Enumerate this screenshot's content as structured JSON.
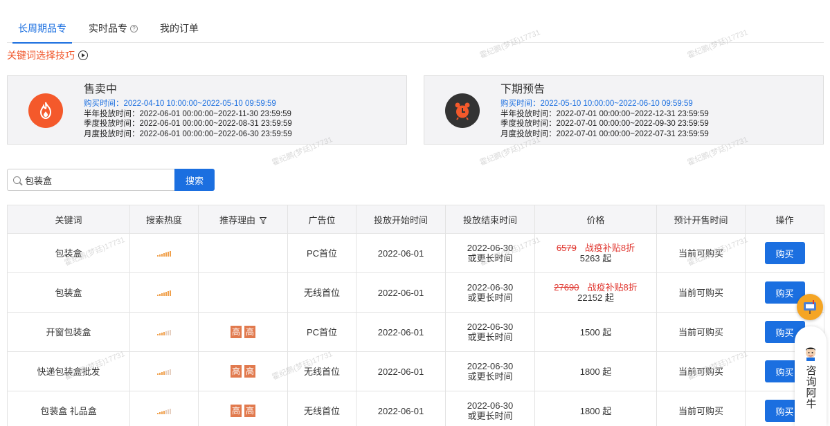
{
  "tabs": [
    {
      "label": "长周期品专",
      "active": true
    },
    {
      "label": "实时品专",
      "active": false,
      "has_help": true
    },
    {
      "label": "我的订单",
      "active": false
    }
  ],
  "tips": {
    "label": "关键词选择技巧",
    "icon": "play-circle-icon"
  },
  "panels": {
    "selling": {
      "title": "售卖中",
      "icon": "fire-icon",
      "icon_color": "#f4592b",
      "buy_time": "购买时间：2022-04-10 10:00:00~2022-05-10 09:59:59",
      "half_year": "半年投放时间：2022-06-01 00:00:00~2022-11-30 23:59:59",
      "quarter": "季度投放时间：2022-06-01 00:00:00~2022-08-31 23:59:59",
      "month": "月度投放时间：2022-06-01 00:00:00~2022-06-30 23:59:59"
    },
    "upcoming": {
      "title": "下期预告",
      "icon": "alarm-clock-icon",
      "icon_color": "#333333",
      "buy_time": "购买时间：2022-05-10 10:00:00~2022-06-10 09:59:59",
      "half_year": "半年投放时间：2022-07-01 00:00:00~2022-12-31 23:59:59",
      "quarter": "季度投放时间：2022-07-01 00:00:00~2022-09-30 23:59:59",
      "month": "月度投放时间：2022-07-01 00:00:00~2022-07-31 23:59:59"
    }
  },
  "search": {
    "value": "包装盒",
    "button": "搜索"
  },
  "table": {
    "headers": {
      "keyword": "关键词",
      "heat": "搜索热度",
      "reason": "推荐理由",
      "position": "广告位",
      "start": "投放开始时间",
      "end": "投放结束时间",
      "price": "价格",
      "sale_time": "预计开售时间",
      "action": "操作"
    },
    "rows": [
      {
        "keyword": "包装盒",
        "heat": 5,
        "tags": [],
        "position": "PC首位",
        "start": "2022-06-01",
        "end_line1": "2022-06-30",
        "end_line2": "或更长时间",
        "orig_price": "6579",
        "discount": "战疫补贴8折",
        "price": "5263 起",
        "sale_time": "当前可购买",
        "action": "购买"
      },
      {
        "keyword": "包装盒",
        "heat": 5,
        "tags": [],
        "position": "无线首位",
        "start": "2022-06-01",
        "end_line1": "2022-06-30",
        "end_line2": "或更长时间",
        "orig_price": "27690",
        "discount": "战疫补贴8折",
        "price": "22152 起",
        "sale_time": "当前可购买",
        "action": "购买"
      },
      {
        "keyword": "开窗包装盒",
        "heat": 2,
        "tags": [
          "高",
          "高"
        ],
        "position": "PC首位",
        "start": "2022-06-01",
        "end_line1": "2022-06-30",
        "end_line2": "或更长时间",
        "orig_price": "",
        "discount": "",
        "price": "1500 起",
        "sale_time": "当前可购买",
        "action": "购买"
      },
      {
        "keyword": "快递包装盒批发",
        "heat": 2,
        "tags": [
          "高",
          "高"
        ],
        "position": "无线首位",
        "start": "2022-06-01",
        "end_line1": "2022-06-30",
        "end_line2": "或更长时间",
        "orig_price": "",
        "discount": "",
        "price": "1800 起",
        "sale_time": "当前可购买",
        "action": "购买"
      },
      {
        "keyword": "包装盒 礼品盒",
        "heat": 2,
        "tags": [
          "高",
          "高"
        ],
        "position": "无线首位",
        "start": "2022-06-01",
        "end_line1": "2022-06-30",
        "end_line2": "或更长时间",
        "orig_price": "",
        "discount": "",
        "price": "1800 起",
        "sale_time": "当前可购买",
        "action": "购买"
      }
    ]
  },
  "float": {
    "consult_label": "咨询阿牛",
    "bubble_icon": "mailbox-icon",
    "avatar_icon": "cow-avatar-icon"
  },
  "watermark": "霍纪鹏(梦廷)17731",
  "colors": {
    "accent": "#1b6fe0",
    "warning": "#f0562a",
    "price_red": "#e0362f",
    "tag": "#e17a4e"
  }
}
